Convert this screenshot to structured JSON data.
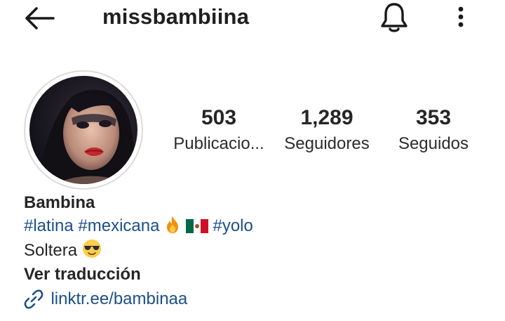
{
  "header": {
    "username": "missbambiina",
    "back_icon": "arrow-left-icon",
    "bell_icon": "bell-icon",
    "menu_icon": "more-vertical-icon"
  },
  "stats": {
    "posts": {
      "count": "503",
      "label": "Publicacio..."
    },
    "followers": {
      "count": "1,289",
      "label": "Seguidores"
    },
    "following": {
      "count": "353",
      "label": "Seguidos"
    }
  },
  "profile": {
    "display_name": "Bambina",
    "hashtag_latina": "#latina",
    "hashtag_mexicana": "#mexicana",
    "hashtag_yolo": "#yolo",
    "status": "Soltera",
    "translate_label": "Ver traducción",
    "link_text": "linktr.ee/bambinaa",
    "link_icon": "link-icon"
  },
  "colors": {
    "link": "#1c4f8a",
    "text": "#262626",
    "ring": "#dbdbdb"
  }
}
